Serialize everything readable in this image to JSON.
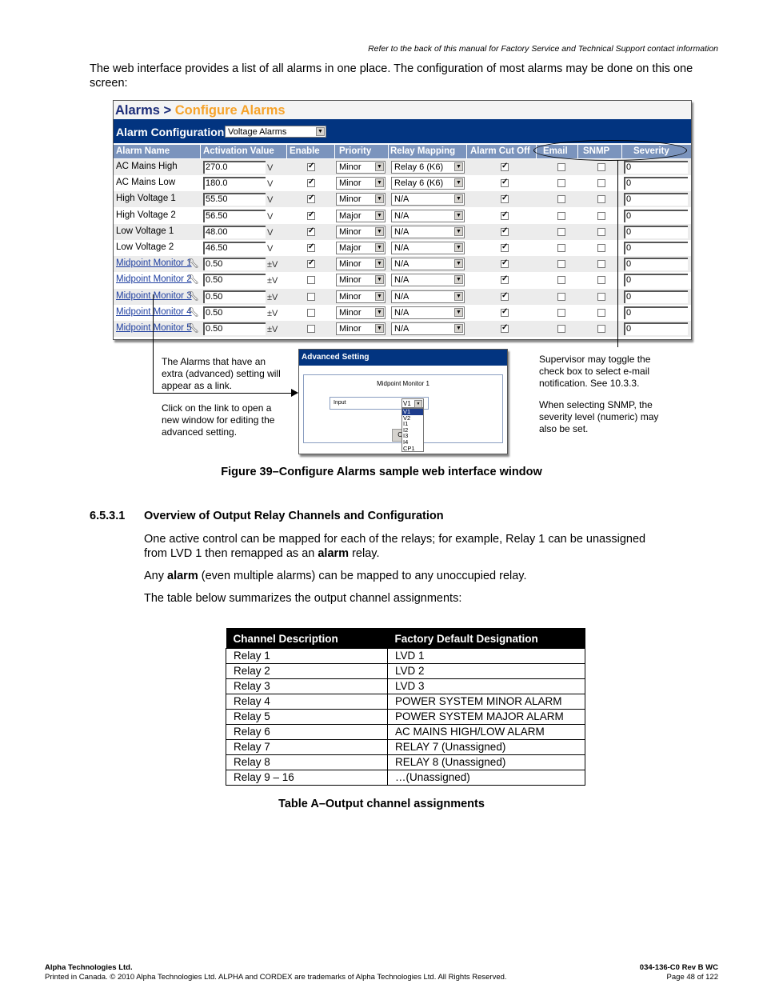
{
  "header_note": "Refer to the back of this manual for Factory Service and Technical Support contact information",
  "intro": "The web interface provides a list of all alarms in one place. The configuration of most alarms may be done on this one screen:",
  "ui": {
    "breadcrumb_parent": "Alarms >",
    "breadcrumb_current": "Configure Alarms",
    "config_label": "Alarm Configuration",
    "config_select": "Voltage Alarms",
    "columns": [
      "Alarm Name",
      "Activation Value",
      "Enable",
      "Priority",
      "Relay Mapping",
      "Alarm Cut Off",
      "Email",
      "SNMP",
      "Severity"
    ],
    "rows": [
      {
        "name": "AC Mains High",
        "link": false,
        "value": "270.0",
        "unit": "V",
        "enable": true,
        "priority": "Minor",
        "relay": "Relay 6 (K6)",
        "aco": true,
        "email": false,
        "snmp": false,
        "severity": "0"
      },
      {
        "name": "AC Mains Low",
        "link": false,
        "value": "180.0",
        "unit": "V",
        "enable": true,
        "priority": "Minor",
        "relay": "Relay 6 (K6)",
        "aco": true,
        "email": false,
        "snmp": false,
        "severity": "0"
      },
      {
        "name": "High Voltage 1",
        "link": false,
        "value": "55.50",
        "unit": "V",
        "enable": true,
        "priority": "Minor",
        "relay": "N/A",
        "aco": true,
        "email": false,
        "snmp": false,
        "severity": "0"
      },
      {
        "name": "High Voltage 2",
        "link": false,
        "value": "56.50",
        "unit": "V",
        "enable": true,
        "priority": "Major",
        "relay": "N/A",
        "aco": true,
        "email": false,
        "snmp": false,
        "severity": "0"
      },
      {
        "name": "Low Voltage 1",
        "link": false,
        "value": "48.00",
        "unit": "V",
        "enable": true,
        "priority": "Minor",
        "relay": "N/A",
        "aco": true,
        "email": false,
        "snmp": false,
        "severity": "0"
      },
      {
        "name": "Low Voltage 2",
        "link": false,
        "value": "46.50",
        "unit": "V",
        "enable": true,
        "priority": "Major",
        "relay": "N/A",
        "aco": true,
        "email": false,
        "snmp": false,
        "severity": "0"
      },
      {
        "name": "Midpoint Monitor 1",
        "link": true,
        "value": "0.50",
        "unit": "±V",
        "enable": true,
        "priority": "Minor",
        "relay": "N/A",
        "aco": true,
        "email": false,
        "snmp": false,
        "severity": "0"
      },
      {
        "name": "Midpoint Monitor 2",
        "link": true,
        "value": "0.50",
        "unit": "±V",
        "enable": false,
        "priority": "Minor",
        "relay": "N/A",
        "aco": true,
        "email": false,
        "snmp": false,
        "severity": "0"
      },
      {
        "name": "Midpoint Monitor 3",
        "link": true,
        "value": "0.50",
        "unit": "±V",
        "enable": false,
        "priority": "Minor",
        "relay": "N/A",
        "aco": true,
        "email": false,
        "snmp": false,
        "severity": "0"
      },
      {
        "name": "Midpoint Monitor 4",
        "link": true,
        "value": "0.50",
        "unit": "±V",
        "enable": false,
        "priority": "Minor",
        "relay": "N/A",
        "aco": true,
        "email": false,
        "snmp": false,
        "severity": "0"
      },
      {
        "name": "Midpoint Monitor 5",
        "link": true,
        "value": "0.50",
        "unit": "±V",
        "enable": false,
        "priority": "Minor",
        "relay": "N/A",
        "aco": true,
        "email": false,
        "snmp": false,
        "severity": "0"
      }
    ]
  },
  "annotations": {
    "left_1": "The Alarms that have an extra (advanced) setting will appear as a link.",
    "left_2": "Click on the link to open a new window for editing the advanced setting.",
    "right_1": "Supervisor may toggle the check box to select e-mail notification. See 10.3.3.",
    "right_2": "When selecting SNMP, the severity level (numeric) may also be set."
  },
  "advanced": {
    "title": "Advanced Setting",
    "name": "Midpoint Monitor 1",
    "input_label": "Input",
    "input_value": "V1",
    "options": [
      "V1",
      "V2",
      "I1",
      "I2",
      "I3",
      "I4",
      "CP1"
    ],
    "close_label": "Cl"
  },
  "figure_caption": "Figure 39–Configure Alarms sample web interface window",
  "section": {
    "number": "6.5.3.1",
    "title": "Overview of Output Relay Channels and Configuration",
    "p1_a": "One active control can be mapped for each of the relays; for example, Relay 1 can be unassigned from LVD 1 then remapped as an ",
    "p1_bold": "alarm",
    "p1_b": " relay.",
    "p2_a": "Any ",
    "p2_bold": "alarm",
    "p2_b": " (even multiple alarms) can be mapped to any unoccupied relay.",
    "p3": "The table below summarizes the output channel assignments:"
  },
  "table": {
    "headers": [
      "Channel Description",
      "Factory Default Designation"
    ],
    "rows": [
      [
        "Relay 1",
        "LVD 1"
      ],
      [
        "Relay 2",
        "LVD 2"
      ],
      [
        "Relay 3",
        "LVD 3"
      ],
      [
        "Relay 4",
        "POWER SYSTEM MINOR ALARM"
      ],
      [
        "Relay 5",
        "POWER SYSTEM MAJOR ALARM"
      ],
      [
        "Relay 6",
        "AC MAINS HIGH/LOW ALARM"
      ],
      [
        "Relay 7",
        "RELAY 7 (Unassigned)"
      ],
      [
        "Relay 8",
        "RELAY 8 (Unassigned)"
      ],
      [
        "Relay 9 – 16",
        "…(Unassigned)"
      ]
    ],
    "caption": "Table A–Output channel assignments"
  },
  "footer": {
    "company": "Alpha Technologies Ltd.",
    "copyright": "Printed in Canada.  © 2010 Alpha Technologies Ltd.  ALPHA and CORDEX are trademarks of Alpha Technologies Ltd.  All Rights Reserved.",
    "doc_id": "034-136-C0  Rev B  WC",
    "page": "Page 48 of 122"
  }
}
